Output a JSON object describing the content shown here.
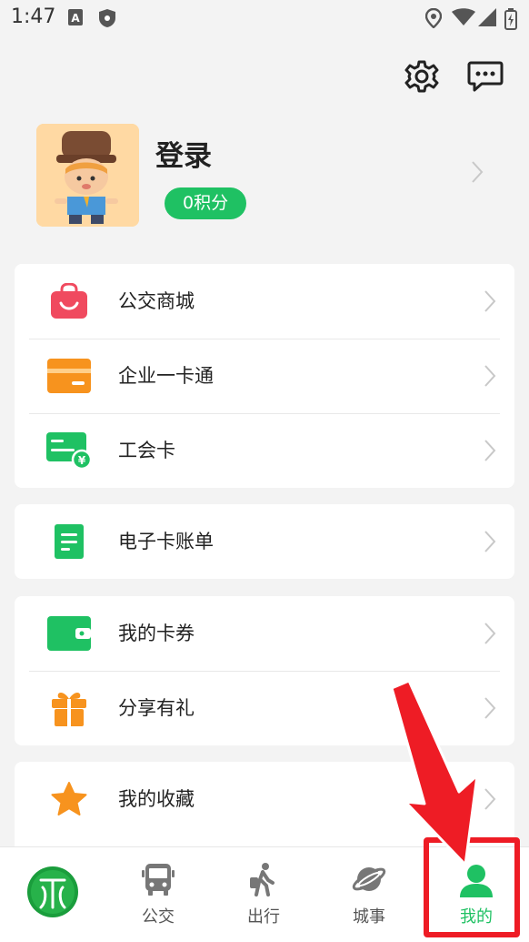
{
  "status_bar": {
    "time": "1:47"
  },
  "profile": {
    "login_label": "登录",
    "points": "0积分"
  },
  "menu_group_1": [
    {
      "label": "公交商城",
      "icon": "shopping-bag-icon"
    },
    {
      "label": "企业一卡通",
      "icon": "card-icon"
    },
    {
      "label": "工会卡",
      "icon": "yuan-card-icon"
    }
  ],
  "menu_group_2": [
    {
      "label": "电子卡账单",
      "icon": "bill-icon"
    }
  ],
  "menu_group_3": [
    {
      "label": "我的卡券",
      "icon": "wallet-icon"
    },
    {
      "label": "分享有礼",
      "icon": "gift-icon"
    }
  ],
  "menu_group_4": [
    {
      "label": "我的收藏",
      "icon": "star-icon"
    }
  ],
  "tabbar": {
    "tabs": [
      {
        "label": "",
        "icon": "app-logo-icon"
      },
      {
        "label": "公交",
        "icon": "bus-icon"
      },
      {
        "label": "出行",
        "icon": "walker-icon"
      },
      {
        "label": "城事",
        "icon": "planet-icon"
      },
      {
        "label": "我的",
        "icon": "person-icon"
      }
    ],
    "active": "我的"
  },
  "colors": {
    "accent": "#1fc163",
    "highlight": "#ee1c25",
    "orange": "#f7931e",
    "pink": "#f04a5f"
  }
}
